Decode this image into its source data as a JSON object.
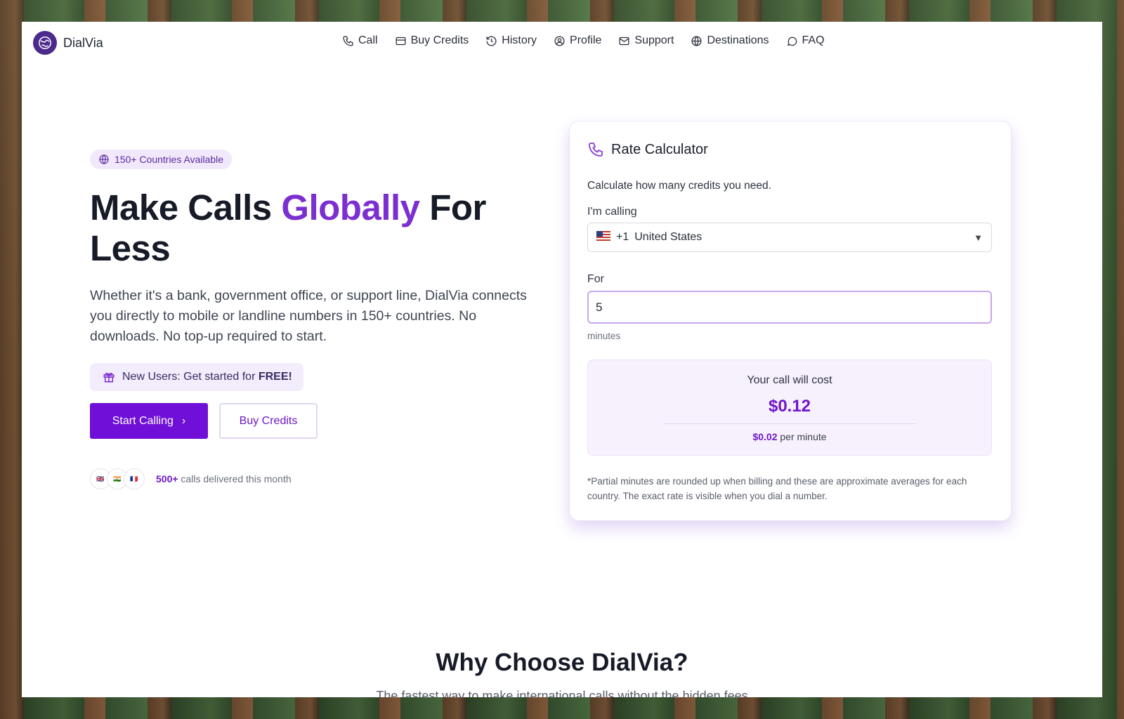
{
  "brand": {
    "name": "DialVia"
  },
  "nav": {
    "items": [
      {
        "label": "Call",
        "icon": "phone-icon"
      },
      {
        "label": "Buy Credits",
        "icon": "card-icon"
      },
      {
        "label": "History",
        "icon": "history-icon"
      },
      {
        "label": "Profile",
        "icon": "user-circle-icon"
      },
      {
        "label": "Support",
        "icon": "mail-icon"
      },
      {
        "label": "Destinations",
        "icon": "globe-icon"
      },
      {
        "label": "FAQ",
        "icon": "chat-icon"
      }
    ]
  },
  "hero": {
    "pill": "150+ Countries Available",
    "headline_part1": "Make Calls ",
    "headline_accent": "Globally",
    "headline_part2": " For Less",
    "lead": "Whether it's a bank, government office, or support line, DialVia connects you directly to mobile or landline numbers in 150+ countries. No downloads. No top-up required to start.",
    "promo_text": "New Users: Get started for ",
    "promo_bold": "FREE!",
    "start_button": "Start Calling",
    "buy_button": "Buy Credits",
    "flags": [
      "UK",
      "IN",
      "FR"
    ],
    "stat_value": "500+",
    "stat_text": " calls delivered this month"
  },
  "calculator": {
    "title": "Rate Calculator",
    "subtitle": "Calculate how many credits you need.",
    "calling_label": "I'm calling",
    "country_code": "+1",
    "country_name": "United States",
    "for_label": "For",
    "minutes_value": "5",
    "minutes_unit": "minutes",
    "cost_label": "Your call will cost",
    "cost_value": "$0.12",
    "rate_value": "$0.02",
    "rate_suffix": " per minute",
    "note": "*Partial minutes are rounded up when billing and these are approximate averages for each country. The exact rate is visible when you dial a number."
  },
  "why": {
    "title": "Why Choose DialVia?",
    "subtitle": "The fastest way to make international calls without the hidden fees"
  },
  "colors": {
    "accent": "#6f0fd8",
    "accent_text": "#7c2fd0",
    "brand_logo": "#4b2a8c"
  }
}
